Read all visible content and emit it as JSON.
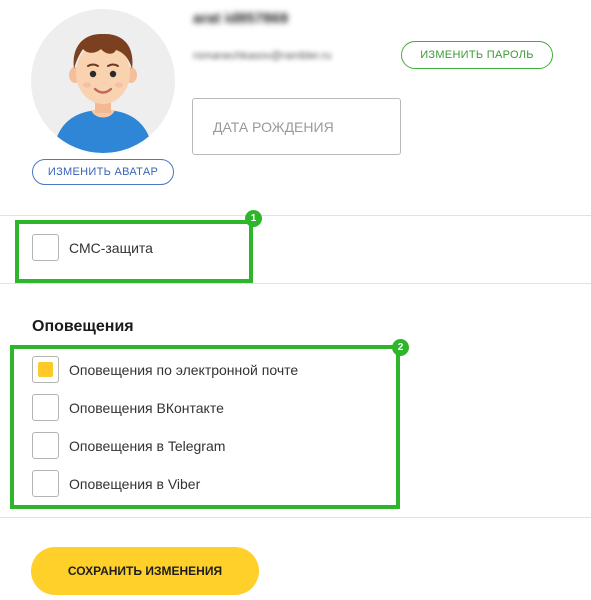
{
  "profile": {
    "name": "arat id857869",
    "email": "romanechkasov@rambler.ru",
    "change_avatar_label": "ИЗМЕНИТЬ АВАТАР",
    "change_password_label": "ИЗМЕНИТЬ ПАРОЛЬ",
    "birth_date": {
      "value": "",
      "placeholder": "ДАТА РОЖДЕНИЯ"
    }
  },
  "security": {
    "sms_protection": {
      "label": "СМС-защита",
      "checked": false
    }
  },
  "notifications": {
    "title": "Оповещения",
    "items": [
      {
        "label": "Оповещения по электронной почте",
        "checked": true
      },
      {
        "label": "Оповещения ВКонтакте",
        "checked": false
      },
      {
        "label": "Оповещения в Telegram",
        "checked": false
      },
      {
        "label": "Оповещения в Viber",
        "checked": false
      }
    ]
  },
  "annotations": {
    "badge_1": "1",
    "badge_2": "2"
  },
  "save_label": "СОХРАНИТЬ ИЗМЕНЕНИЯ",
  "colors": {
    "accent_yellow": "#ffd02a",
    "annotation_green": "#2fb52c",
    "avatar_button_blue": "#4a78c4",
    "password_button_green": "#3fae3b"
  }
}
